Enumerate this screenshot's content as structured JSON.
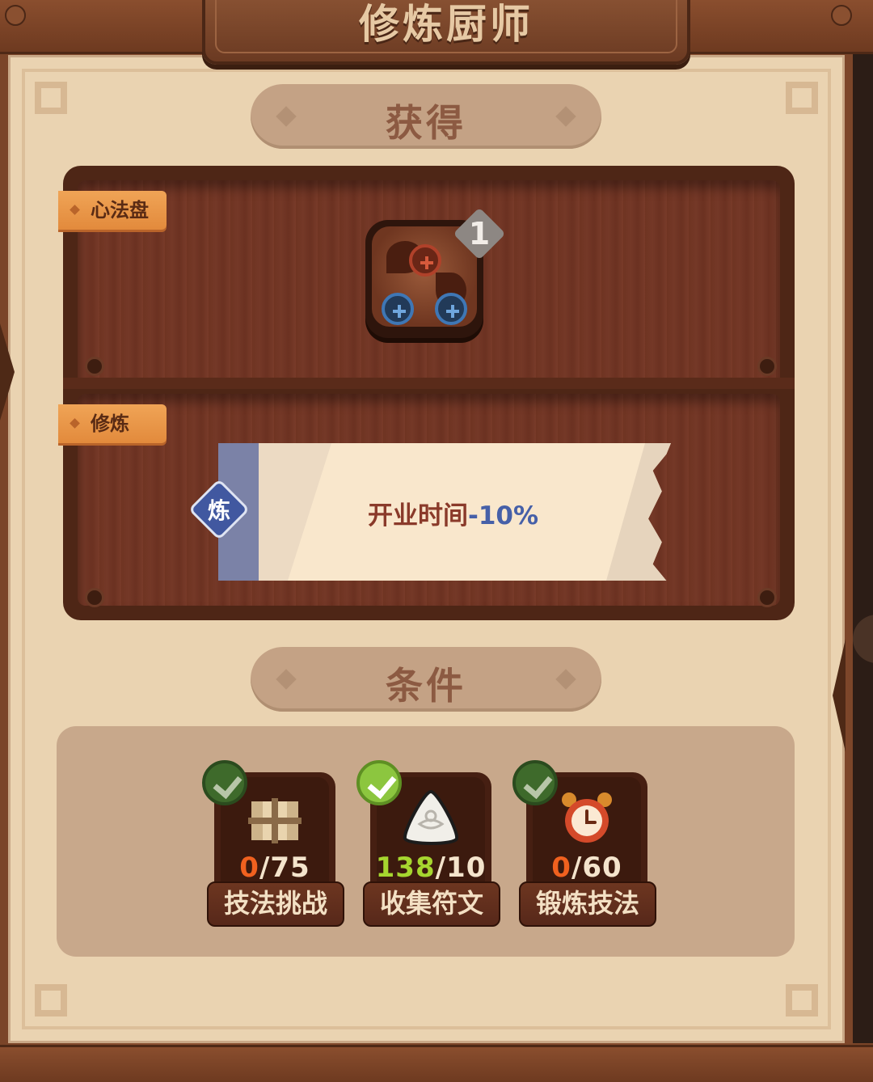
{
  "header": {
    "title": "修炼厨师"
  },
  "sections": {
    "obtain_title": "获得",
    "condition_title": "条件"
  },
  "rewards": {
    "mind_tag": "心法盘",
    "mind_count": "1",
    "train_tag": "修炼",
    "train_badge": "炼",
    "effect_label": "开业时间",
    "effect_value": "-10%"
  },
  "conditions": [
    {
      "current": "0",
      "target": "/75",
      "label": "技法挑战",
      "icon": "scroll-icon",
      "current_color": "#f0611f",
      "complete": false
    },
    {
      "current": "138",
      "target": "/10",
      "label": "收集符文",
      "icon": "rune-stone-icon",
      "current_color": "#a6d62f",
      "complete": true
    },
    {
      "current": "0",
      "target": "/60",
      "label": "锻炼技法",
      "icon": "alarm-clock-icon",
      "current_color": "#f0611f",
      "complete": false
    }
  ],
  "colors": {
    "panel_bg": "#ead3b1",
    "board_wood": "#6f3422",
    "tag_orange": "#e28a3c",
    "effect_value_blue": "#4660a8",
    "check_green_active": "#8cc63f",
    "check_green_dim": "#3f6b2b"
  }
}
